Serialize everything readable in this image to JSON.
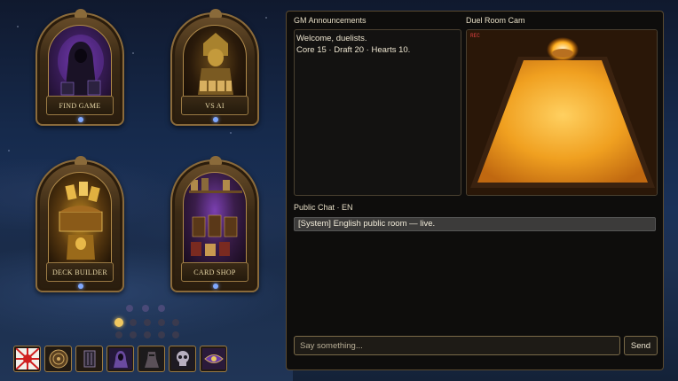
{
  "menu": {
    "tiles": [
      {
        "label": "FIND GAME"
      },
      {
        "label": "VS AI"
      },
      {
        "label": "DECK BUILDER"
      },
      {
        "label": "CARD SHOP"
      }
    ]
  },
  "pager": {
    "active_index": 0
  },
  "icon_bar": [
    {
      "icon": "rising-sun-flag-icon"
    },
    {
      "icon": "mandala-icon"
    },
    {
      "icon": "pillar-icon"
    },
    {
      "icon": "hooded-figure-icon"
    },
    {
      "icon": "dark-knight-icon"
    },
    {
      "icon": "skull-icon"
    },
    {
      "icon": "eye-icon"
    }
  ],
  "announcements": {
    "title": "GM Announcements",
    "lines": [
      "Welcome, duelists.",
      "Core 15 · Draft 20 · Hearts 10."
    ]
  },
  "camera": {
    "title": "Duel Room Cam",
    "rec_label": "REC"
  },
  "chat": {
    "title": "Public Chat · EN",
    "messages": [
      {
        "text": "[System] English public room — live."
      }
    ],
    "input_placeholder": "Say something...",
    "send_label": "Send"
  },
  "colors": {
    "accent_gold": "#9a7a44",
    "active_dot": "#f0c860",
    "panel_bg": "#0e0d0c"
  }
}
